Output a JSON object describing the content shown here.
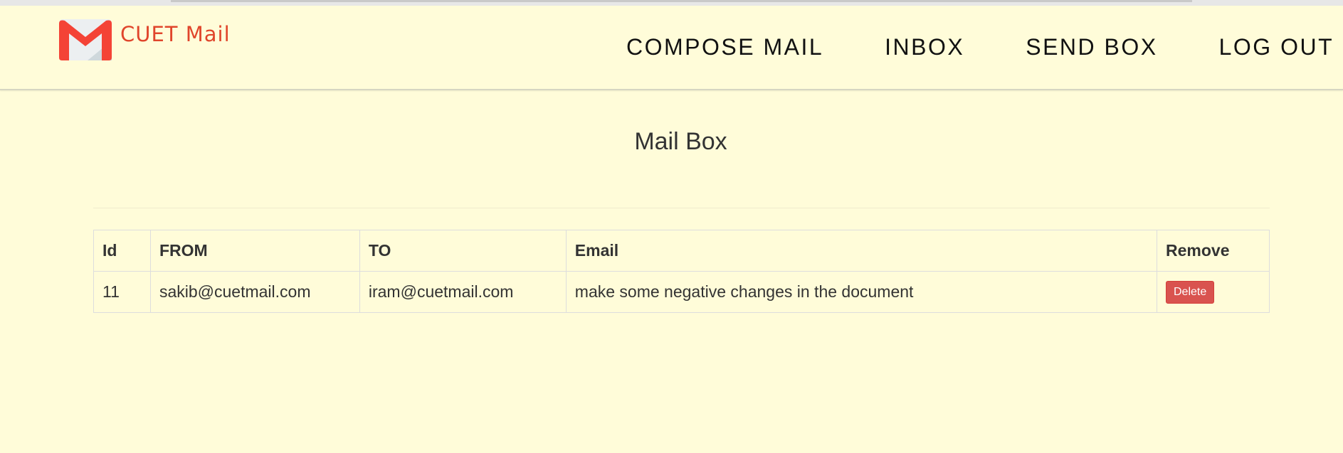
{
  "brand": {
    "name": "CUET Mail"
  },
  "nav": [
    {
      "label": "COMPOSE MAIL"
    },
    {
      "label": "INBOX"
    },
    {
      "label": "SEND BOX"
    },
    {
      "label": "LOG OUT"
    }
  ],
  "page": {
    "title": "Mail Box"
  },
  "table": {
    "headers": [
      "Id",
      "FROM",
      "TO",
      "Email",
      "Remove"
    ],
    "rows": [
      {
        "id": "11",
        "from": "sakib@cuetmail.com",
        "to": "iram@cuetmail.com",
        "email": "make some negative changes in the document",
        "action_label": "Delete"
      }
    ]
  },
  "colors": {
    "background": "#fffcd9",
    "brand": "#e0452b",
    "delete": "#d9534f"
  },
  "icons": {
    "logo": "gmail-style-envelope-icon"
  }
}
